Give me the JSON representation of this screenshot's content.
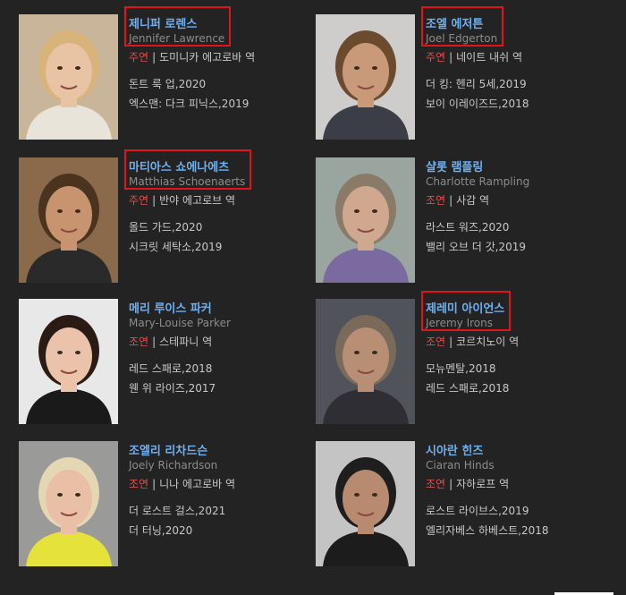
{
  "actors": [
    {
      "name_ko": "제니퍼 로렌스",
      "name_en": "Jennifer Lawrence",
      "role_type": "주연",
      "role": "도미니카 에고로바 역",
      "works": [
        "돈트 룩 업,2020",
        "엑스맨: 다크 피닉스,2019"
      ],
      "highlighted": true,
      "bg": "#c9b59a",
      "skin": "#e8c3a4",
      "hair": "#d8b47a",
      "shirt": "#e9e4da"
    },
    {
      "name_ko": "조엘 에저튼",
      "name_en": "Joel Edgerton",
      "role_type": "주연",
      "role": "네이트 내쉬 역",
      "works": [
        "더 킹: 헨리 5세,2019",
        "보이 이레이즈드,2018"
      ],
      "highlighted": true,
      "bg": "#cfcdcb",
      "skin": "#c99a7a",
      "hair": "#6b4a2e",
      "shirt": "#3b3e47"
    },
    {
      "name_ko": "마티아스 쇼에나에츠",
      "name_en": "Matthias Schoenaerts",
      "role_type": "주연",
      "role": "반야 에고로브 역",
      "works": [
        "올드 가드,2020",
        "시크릿 세탁소,2019"
      ],
      "highlighted": true,
      "bg": "#8a6a4a",
      "skin": "#c89470",
      "hair": "#4a3420",
      "shirt": "#2a2a2a"
    },
    {
      "name_ko": "샬롯 램플링",
      "name_en": "Charlotte Rampling",
      "role_type": "조연",
      "role": "사감 역",
      "works": [
        "라스트 워즈,2020",
        "밸리 오브 더 갓,2019"
      ],
      "highlighted": false,
      "bg": "#9aa5a0",
      "skin": "#d0a890",
      "hair": "#8a7a68",
      "shirt": "#7b6aa0"
    },
    {
      "name_ko": "메리 루이스 파커",
      "name_en": "Mary-Louise Parker",
      "role_type": "조연",
      "role": "스테파니 역",
      "works": [
        "레드 스패로,2018",
        "웬 위 라이즈,2017"
      ],
      "highlighted": false,
      "bg": "#e8e8e8",
      "skin": "#eac3aa",
      "hair": "#2a1c14",
      "shirt": "#1a1a1a"
    },
    {
      "name_ko": "제레미 아이언스",
      "name_en": "Jeremy Irons",
      "role_type": "조연",
      "role": "코르치노이 역",
      "works": [
        "모뉴멘탈,2018",
        "레드 스패로,2018"
      ],
      "highlighted": true,
      "bg": "#50545a",
      "skin": "#b88e74",
      "hair": "#7a6a5a",
      "shirt": "#2e2e34"
    },
    {
      "name_ko": "조엘리 리차드슨",
      "name_en": "Joely Richardson",
      "role_type": "조연",
      "role": "니나 에고로바 역",
      "works": [
        "더 로스트 걸스,2021",
        "더 터닝,2020"
      ],
      "highlighted": false,
      "bg": "#9a9a98",
      "skin": "#e9c0a6",
      "hair": "#e5d6b4",
      "shirt": "#e6e23c"
    },
    {
      "name_ko": "시아란 힌즈",
      "name_en": "Ciaran Hinds",
      "role_type": "조연",
      "role": "자하로프 역",
      "works": [
        "로스트 라이브스,2019",
        "엘리자베스 하베스트,2018"
      ],
      "highlighted": false,
      "bg": "#c4c4c4",
      "skin": "#b88a70",
      "hair": "#1e1e1e",
      "shirt": "#1c1c1c"
    }
  ]
}
